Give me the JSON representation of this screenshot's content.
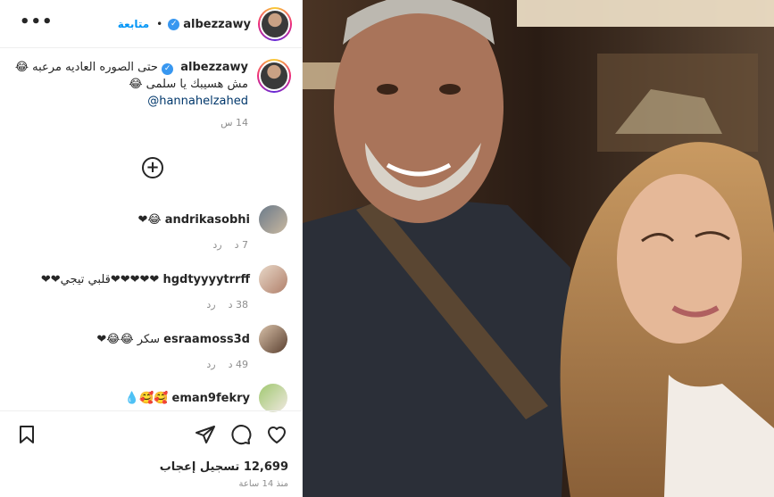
{
  "post": {
    "username": "albezzawy",
    "follow_label": "متابعة",
    "bullet": "•",
    "more": "•••"
  },
  "caption": {
    "username": "albezzawy",
    "line1": "حتى الصوره العاديه مرعبه 😂",
    "line2": "مش هسيبك يا سلمى 😂",
    "mention": "@hannahelzahed",
    "time": "14 س"
  },
  "comments": [
    {
      "username": "andrikasobhi",
      "text": "😂❤",
      "age": "7 د",
      "reply": "رد"
    },
    {
      "username": "hgdtyyyytrrff",
      "text": "❤❤❤❤❤قلبي تيجي❤❤",
      "age": "38 د",
      "reply": "رد"
    },
    {
      "username": "esraamoss3d",
      "text": "سكر 😂😂❤",
      "age": "49 د",
      "reply": "رد"
    },
    {
      "username": "eman9fekry",
      "text": "🥰🥰💧"
    }
  ],
  "footer": {
    "likes": "12,699 تسجيل إعجاب",
    "since": "منذ 14 ساعة"
  },
  "icons": [
    "more-icon",
    "verified-icon",
    "add-comment-icon",
    "save-icon",
    "share-icon",
    "comment-icon",
    "like-icon"
  ],
  "colors": {
    "link": "#0095f6",
    "mention": "#00376b",
    "verified": "#3897f0",
    "muted": "#8e8e8e"
  }
}
